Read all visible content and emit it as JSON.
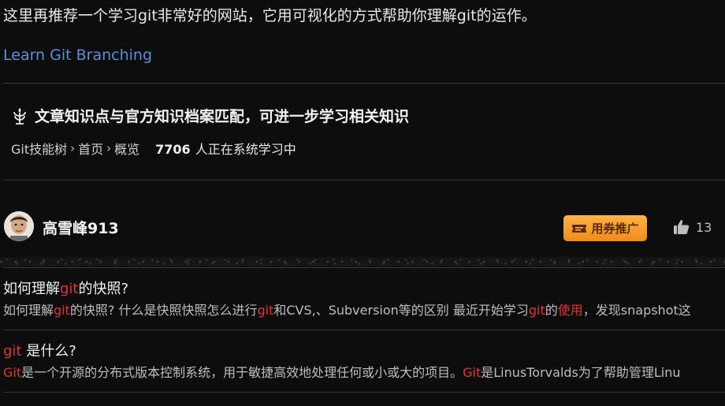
{
  "intro": {
    "text": "这里再推荐一个学习git非常好的网站，它用可视化的方式帮助你理解git的运作。",
    "link_label": "Learn Git Branching"
  },
  "knowledge": {
    "title": "文章知识点与官方知识档案匹配，可进一步学习相关知识",
    "icon": "knowledge-icon",
    "path": [
      "Git技能树",
      "首页",
      "概览"
    ],
    "learner_count": "7706",
    "learner_suffix": "人正在系统学习中"
  },
  "author": {
    "name": "高雪峰913",
    "coupon_label": "用券推广",
    "like_count": "13"
  },
  "related": [
    {
      "title_parts": [
        "如何理解",
        "git",
        "的快照?"
      ],
      "desc_parts": [
        "如何理解",
        "git",
        "的快照? 什么是快照快照怎么进行",
        "git",
        "和CVS,、Subversion等的区别 最近开始学习",
        "git",
        "的",
        "使用",
        "，发现snapshot这"
      ]
    },
    {
      "title_parts": [
        "git",
        " 是什么?"
      ],
      "desc_parts": [
        "Git",
        "是一个开源的分布式版本控制系统，用于敏捷高效地处理任何或小或大的项目。",
        "Git",
        "是LinusTorvalds为了帮助管理Linu"
      ]
    }
  ],
  "colors": {
    "link": "#5b8fd6",
    "highlight": "#e3352b",
    "coupon": "#f08a18",
    "background": "#0d0d0d"
  }
}
